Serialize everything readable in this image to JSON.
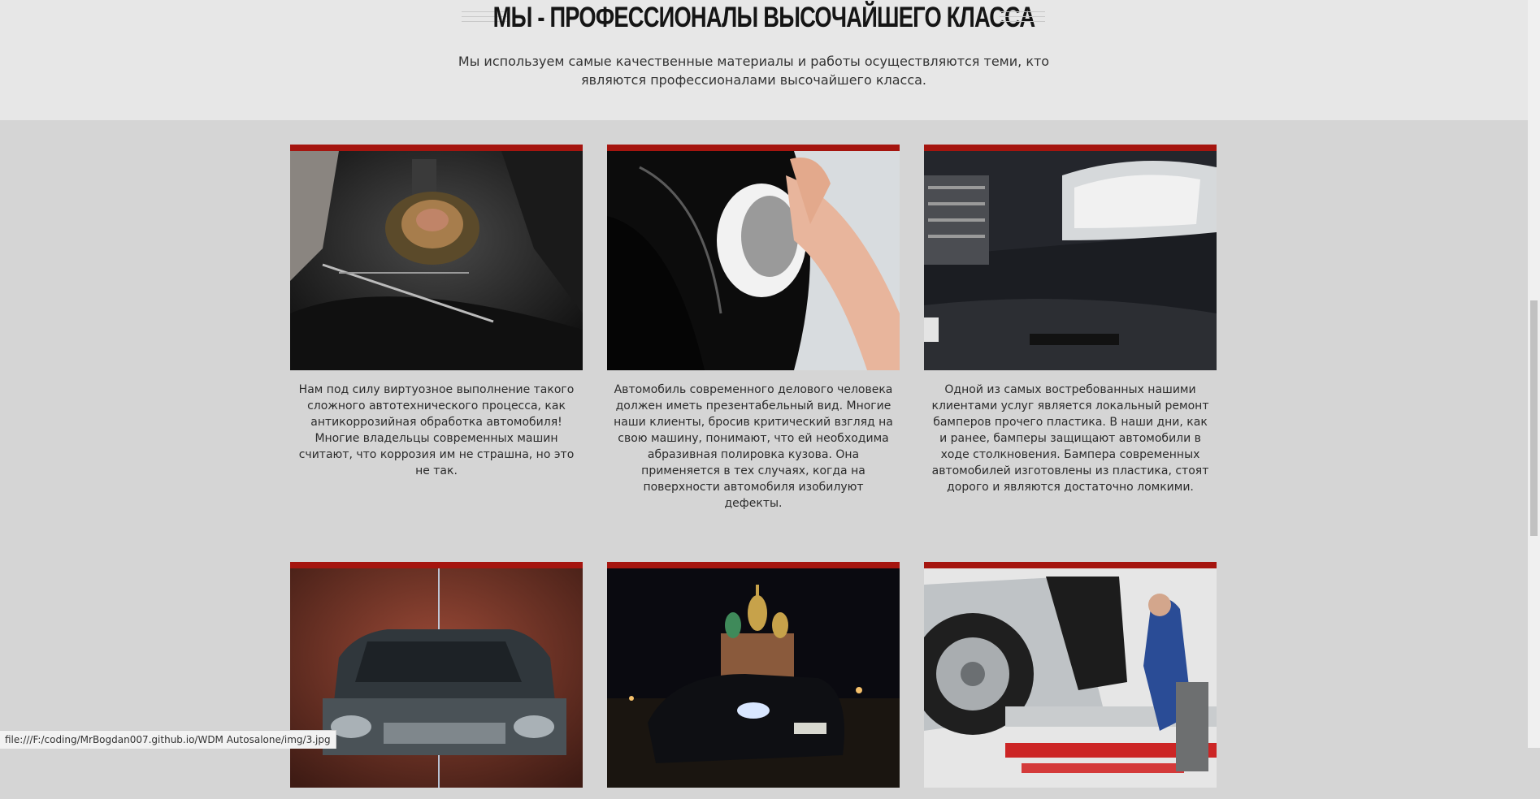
{
  "header": {
    "title": "МЫ - ПРОФЕССИОНАЛЫ ВЫСОЧАЙШЕГО КЛАССА",
    "subtitle": "Мы используем самые качественные материалы и работы осуществляются теми, кто являются профессионалами высочайшего класса."
  },
  "cards": [
    {
      "image": "underbody-anticorrosion-photo",
      "text": "Нам под силу виртуозное выполнение такого сложного автотехнического процесса, как антикоррозийная обработка автомобиля! Многие владельцы современных машин считают, что коррозия им не страшна, но это не так."
    },
    {
      "image": "polishing-car-photo",
      "text": "Автомобиль современного делового человека должен иметь презентабельный вид. Многие наши клиенты, бросив критический взгляд на свою машину, понимают, что ей необходима абразивная полировка кузова. Она применяется в тех случаях, когда на поверхности автомобиля изобилуют дефекты."
    },
    {
      "image": "bumper-repair-photo",
      "text": "Одной из самых востребованных нашими клиентами услуг является локальный ремонт бамперов прочего пластика. В наши дни, как и ранее, бамперы защищают автомобили в ходе столкновения. Бампера современных автомобилей изготовлены из пластика, стоят дорого и являются достаточно ломкими."
    },
    {
      "image": "crashed-suv-photo",
      "text": ""
    },
    {
      "image": "night-car-red-square-photo",
      "text": ""
    },
    {
      "image": "body-repair-frame-photo",
      "text": ""
    }
  ],
  "status_url": "file:///F:/coding/MrBogdan007.github.io/WDM Autosalone/img/3.jpg",
  "colors": {
    "accent": "#a5150f",
    "top_bg": "#e7e7e7",
    "body_bg": "#d5d5d5"
  }
}
